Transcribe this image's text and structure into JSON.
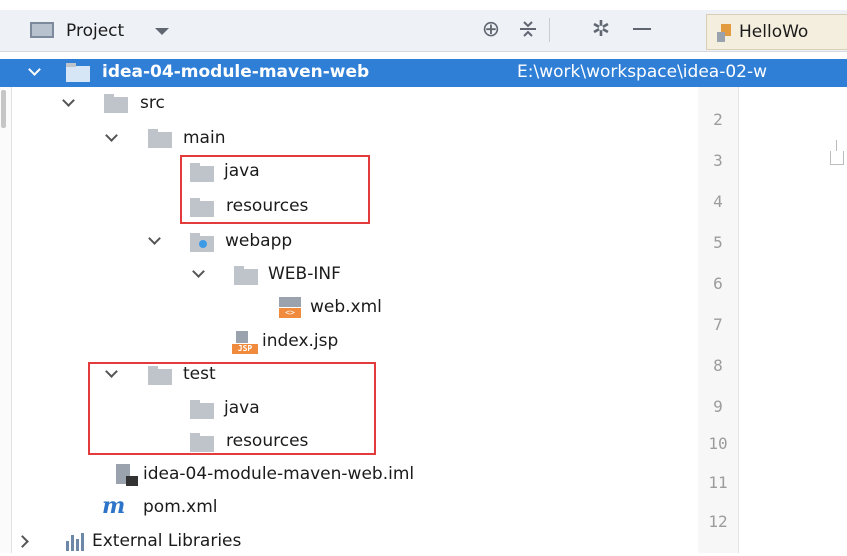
{
  "toolbar": {
    "view_label": "Project",
    "target_icon": "target-icon",
    "collapse_icon": "collapse-all-icon",
    "settings_icon": "gear-icon",
    "hide_icon": "minimize-icon",
    "editor_tab_label": "HelloWo"
  },
  "tree": {
    "root_name": "idea-04-module-maven-web",
    "root_path": "E:\\work\\workspace\\idea-02-w",
    "src": "src",
    "main": "main",
    "main_java": "java",
    "main_resources": "resources",
    "webapp": "webapp",
    "web_inf": "WEB-INF",
    "web_xml": "web.xml",
    "index_jsp": "index.jsp",
    "test": "test",
    "test_java": "java",
    "test_resources": "resources",
    "iml": "idea-04-module-maven-web.iml",
    "pom": "pom.xml",
    "external_libraries": "External Libraries"
  },
  "icons": {
    "xml_badge": "<>",
    "jsp_badge": "JSP",
    "maven_badge": "m"
  },
  "gutter": {
    "line_numbers": [
      "2",
      "3",
      "4",
      "5",
      "6",
      "7",
      "8",
      "9",
      "10",
      "11",
      "12"
    ]
  },
  "colors": {
    "selection": "#2f7fd6",
    "highlight_box": "#e33b3b",
    "folder": "#bfc4cb"
  }
}
